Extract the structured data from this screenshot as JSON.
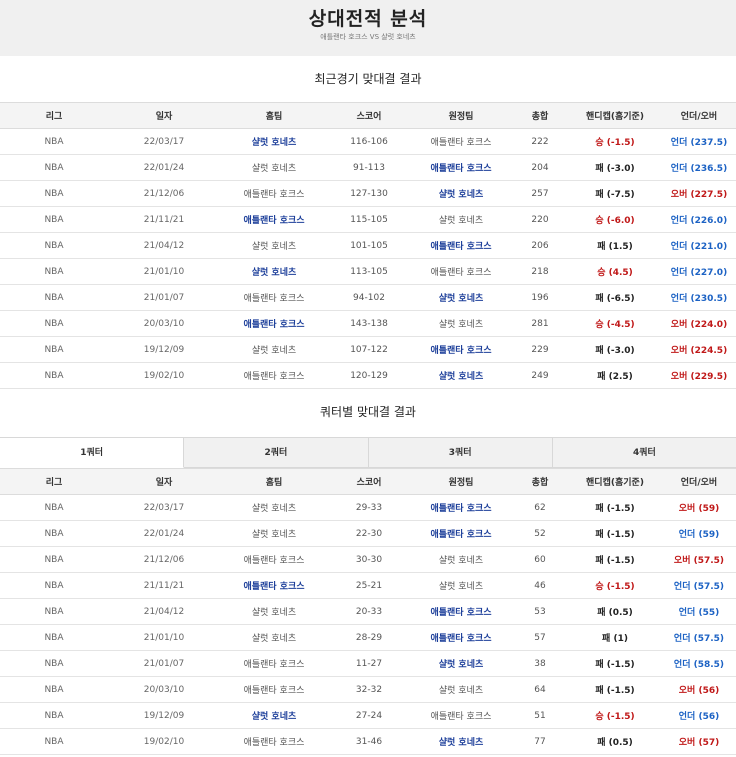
{
  "header": {
    "title": "상대전적 분석",
    "subtitle": "애틀랜타 호크스 VS 샬럿 호네츠"
  },
  "recent": {
    "title": "최근경기 맞대결 결과",
    "columns": [
      "리그",
      "일자",
      "홈팀",
      "스코어",
      "원정팀",
      "총합",
      "핸디캡(홈기준)",
      "언더/오버"
    ],
    "rows": [
      {
        "league": "NBA",
        "date": "22/03/17",
        "home": "샬럿 호네츠",
        "score": "116-106",
        "away": "애틀랜타 호크스",
        "total": "222",
        "handicap": "승 (-1.5)",
        "ou": "언더 (237.5)",
        "winner": "home",
        "hres": "win",
        "outype": "under"
      },
      {
        "league": "NBA",
        "date": "22/01/24",
        "home": "샬럿 호네츠",
        "score": "91-113",
        "away": "애틀랜타 호크스",
        "total": "204",
        "handicap": "패 (-3.0)",
        "ou": "언더 (236.5)",
        "winner": "away",
        "hres": "lose",
        "outype": "under"
      },
      {
        "league": "NBA",
        "date": "21/12/06",
        "home": "애틀랜타 호크스",
        "score": "127-130",
        "away": "샬럿 호네츠",
        "total": "257",
        "handicap": "패 (-7.5)",
        "ou": "오버 (227.5)",
        "winner": "away",
        "hres": "lose",
        "outype": "over"
      },
      {
        "league": "NBA",
        "date": "21/11/21",
        "home": "애틀랜타 호크스",
        "score": "115-105",
        "away": "샬럿 호네츠",
        "total": "220",
        "handicap": "승 (-6.0)",
        "ou": "언더 (226.0)",
        "winner": "home",
        "hres": "win",
        "outype": "under"
      },
      {
        "league": "NBA",
        "date": "21/04/12",
        "home": "샬럿 호네츠",
        "score": "101-105",
        "away": "애틀랜타 호크스",
        "total": "206",
        "handicap": "패 (1.5)",
        "ou": "언더 (221.0)",
        "winner": "away",
        "hres": "lose",
        "outype": "under"
      },
      {
        "league": "NBA",
        "date": "21/01/10",
        "home": "샬럿 호네츠",
        "score": "113-105",
        "away": "애틀랜타 호크스",
        "total": "218",
        "handicap": "승 (4.5)",
        "ou": "언더 (227.0)",
        "winner": "home",
        "hres": "win",
        "outype": "under"
      },
      {
        "league": "NBA",
        "date": "21/01/07",
        "home": "애틀랜타 호크스",
        "score": "94-102",
        "away": "샬럿 호네츠",
        "total": "196",
        "handicap": "패 (-6.5)",
        "ou": "언더 (230.5)",
        "winner": "away",
        "hres": "lose",
        "outype": "under"
      },
      {
        "league": "NBA",
        "date": "20/03/10",
        "home": "애틀랜타 호크스",
        "score": "143-138",
        "away": "샬럿 호네츠",
        "total": "281",
        "handicap": "승 (-4.5)",
        "ou": "오버 (224.0)",
        "winner": "home",
        "hres": "win",
        "outype": "over"
      },
      {
        "league": "NBA",
        "date": "19/12/09",
        "home": "샬럿 호네츠",
        "score": "107-122",
        "away": "애틀랜타 호크스",
        "total": "229",
        "handicap": "패 (-3.0)",
        "ou": "오버 (224.5)",
        "winner": "away",
        "hres": "lose",
        "outype": "over"
      },
      {
        "league": "NBA",
        "date": "19/02/10",
        "home": "애틀랜타 호크스",
        "score": "120-129",
        "away": "샬럿 호네츠",
        "total": "249",
        "handicap": "패 (2.5)",
        "ou": "오버 (229.5)",
        "winner": "away",
        "hres": "lose",
        "outype": "over"
      }
    ]
  },
  "quarter": {
    "title": "쿼터별 맞대결 결과",
    "tabs": [
      "1쿼터",
      "2쿼터",
      "3쿼터",
      "4쿼터"
    ],
    "active_tab": 0,
    "columns": [
      "리그",
      "일자",
      "홈팀",
      "스코어",
      "원정팀",
      "총합",
      "핸디캡(홈기준)",
      "언더/오버"
    ],
    "rows": [
      {
        "league": "NBA",
        "date": "22/03/17",
        "home": "샬럿 호네츠",
        "score": "29-33",
        "away": "애틀랜타 호크스",
        "total": "62",
        "handicap": "패 (-1.5)",
        "ou": "오버 (59)",
        "winner": "away",
        "hres": "lose",
        "outype": "over"
      },
      {
        "league": "NBA",
        "date": "22/01/24",
        "home": "샬럿 호네츠",
        "score": "22-30",
        "away": "애틀랜타 호크스",
        "total": "52",
        "handicap": "패 (-1.5)",
        "ou": "언더 (59)",
        "winner": "away",
        "hres": "lose",
        "outype": "under"
      },
      {
        "league": "NBA",
        "date": "21/12/06",
        "home": "애틀랜타 호크스",
        "score": "30-30",
        "away": "샬럿 호네츠",
        "total": "60",
        "handicap": "패 (-1.5)",
        "ou": "오버 (57.5)",
        "winner": "none",
        "hres": "lose",
        "outype": "over"
      },
      {
        "league": "NBA",
        "date": "21/11/21",
        "home": "애틀랜타 호크스",
        "score": "25-21",
        "away": "샬럿 호네츠",
        "total": "46",
        "handicap": "승 (-1.5)",
        "ou": "언더 (57.5)",
        "winner": "home",
        "hres": "win",
        "outype": "under"
      },
      {
        "league": "NBA",
        "date": "21/04/12",
        "home": "샬럿 호네츠",
        "score": "20-33",
        "away": "애틀랜타 호크스",
        "total": "53",
        "handicap": "패 (0.5)",
        "ou": "언더 (55)",
        "winner": "away",
        "hres": "lose",
        "outype": "under"
      },
      {
        "league": "NBA",
        "date": "21/01/10",
        "home": "샬럿 호네츠",
        "score": "28-29",
        "away": "애틀랜타 호크스",
        "total": "57",
        "handicap": "패 (1)",
        "ou": "언더 (57.5)",
        "winner": "away",
        "hres": "lose",
        "outype": "under"
      },
      {
        "league": "NBA",
        "date": "21/01/07",
        "home": "애틀랜타 호크스",
        "score": "11-27",
        "away": "샬럿 호네츠",
        "total": "38",
        "handicap": "패 (-1.5)",
        "ou": "언더 (58.5)",
        "winner": "away",
        "hres": "lose",
        "outype": "under"
      },
      {
        "league": "NBA",
        "date": "20/03/10",
        "home": "애틀랜타 호크스",
        "score": "32-32",
        "away": "샬럿 호네츠",
        "total": "64",
        "handicap": "패 (-1.5)",
        "ou": "오버 (56)",
        "winner": "none",
        "hres": "lose",
        "outype": "over"
      },
      {
        "league": "NBA",
        "date": "19/12/09",
        "home": "샬럿 호네츠",
        "score": "27-24",
        "away": "애틀랜타 호크스",
        "total": "51",
        "handicap": "승 (-1.5)",
        "ou": "언더 (56)",
        "winner": "home",
        "hres": "win",
        "outype": "under"
      },
      {
        "league": "NBA",
        "date": "19/02/10",
        "home": "애틀랜타 호크스",
        "score": "31-46",
        "away": "샬럿 호네츠",
        "total": "77",
        "handicap": "패 (0.5)",
        "ou": "오버 (57)",
        "winner": "away",
        "hres": "lose",
        "outype": "over"
      }
    ]
  }
}
